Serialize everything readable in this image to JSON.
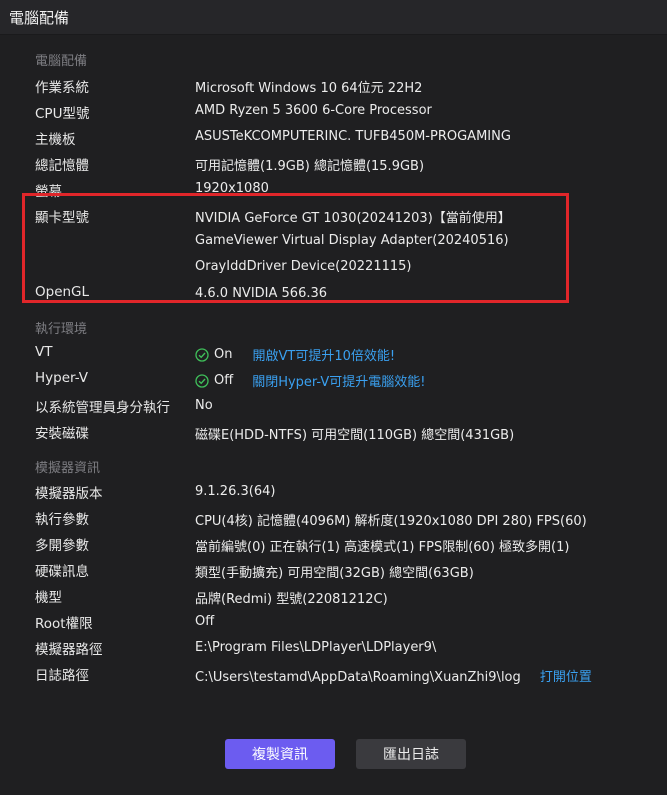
{
  "window": {
    "title": "電腦配備"
  },
  "hardware": {
    "section_title": "電腦配備",
    "os_label": "作業系統",
    "os_value": "Microsoft Windows 10 64位元 22H2",
    "cpu_label": "CPU型號",
    "cpu_value": "AMD Ryzen 5 3600 6-Core Processor",
    "board_label": "主機板",
    "board_value": "ASUSTeKCOMPUTERINC. TUFB450M-PROGAMING",
    "memory_label": "總記憶體",
    "memory_value": "可用記憶體(1.9GB) 總記憶體(15.9GB)",
    "screen_label": "螢幕",
    "screen_value": "1920x1080",
    "gpu_label": "顯卡型號",
    "gpu_values": [
      "NVIDIA GeForce GT 1030(20241203)【當前使用】",
      "GameViewer Virtual Display Adapter(20240516)",
      "OrayIddDriver Device(20221115)"
    ],
    "opengl_label": "OpenGL",
    "opengl_value": "4.6.0 NVIDIA 566.36"
  },
  "environment": {
    "section_title": "執行環境",
    "vt_label": "VT",
    "vt_status": "On",
    "vt_link": "開啟VT可提升10倍效能!",
    "hyperv_label": "Hyper-V",
    "hyperv_status": "Off",
    "hyperv_link": "關閉Hyper-V可提升電腦效能!",
    "admin_label": "以系統管理員身分執行",
    "admin_value": "No",
    "disk_label": "安裝磁碟",
    "disk_value": "磁碟E(HDD-NTFS) 可用空間(110GB) 總空間(431GB)"
  },
  "emulator": {
    "section_title": "模擬器資訊",
    "version_label": "模擬器版本",
    "version_value": "9.1.26.3(64)",
    "params_label": "執行參數",
    "params_value": "CPU(4核) 記憶體(4096M) 解析度(1920x1080 DPI 280) FPS(60)",
    "multi_label": "多開參數",
    "multi_value": "當前編號(0) 正在執行(1) 高速模式(1) FPS限制(60) 極致多開(1)",
    "disk_label": "硬碟訊息",
    "disk_value": "類型(手動擴充) 可用空間(32GB) 總空間(63GB)",
    "model_label": "機型",
    "model_value": "品牌(Redmi) 型號(22081212C)",
    "root_label": "Root權限",
    "root_value": "Off",
    "path_label": "模擬器路徑",
    "path_value": "E:\\Program Files\\LDPlayer\\LDPlayer9\\",
    "log_label": "日誌路徑",
    "log_value": "C:\\Users\\testamd\\AppData\\Roaming\\XuanZhi9\\log",
    "log_link": "打開位置"
  },
  "buttons": {
    "copy_label": "複製資訊",
    "export_label": "匯出日誌"
  },
  "colors": {
    "accent": "#6c5cf0",
    "link": "#3aa0f0",
    "highlight": "#e0262a",
    "ok": "#3fbf5a"
  }
}
